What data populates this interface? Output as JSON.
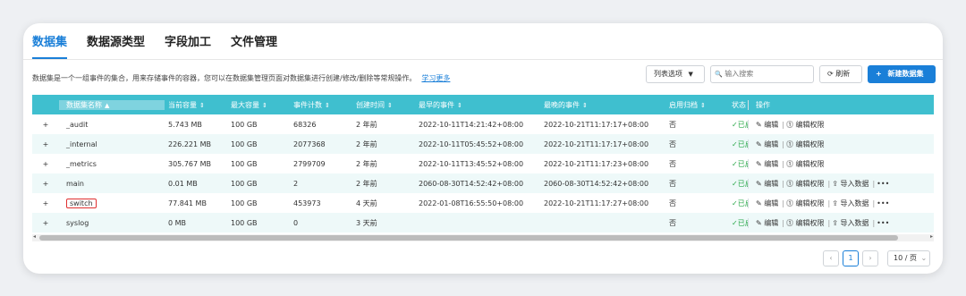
{
  "tabs": [
    "数据集",
    "数据源类型",
    "字段加工",
    "文件管理"
  ],
  "description": "数据集是一个一组事件的集合，用来存储事件的容器，您可以在数据集管理页面对数据集进行创建/修改/删除等常规操作。",
  "learn_more": "学习更多",
  "toolbar": {
    "columns_label": "列表选项",
    "columns_caret": "▼",
    "search_icon": "🔍",
    "search_placeholder": "输入搜索",
    "refresh_label": "刷新",
    "refresh_icon": "⟳",
    "new_label": "新建数据集",
    "new_icon": "+"
  },
  "table": {
    "headers": [
      "数据集名称",
      "当前容量",
      "最大容量",
      "事件计数",
      "创建时间",
      "最早的事件",
      "最晚的事件",
      "启用归档",
      "状态",
      "操作"
    ],
    "sort_icons": [
      "▲",
      "⇕",
      "⇕",
      "⇕",
      "⇕",
      "⇕",
      "⇕",
      "⇕"
    ],
    "expand_icon": "+",
    "rows": [
      {
        "name": "_audit",
        "cur": "5.743 MB",
        "max": "100 GB",
        "count": "68326",
        "created": "2 年前",
        "earliest": "2022-10-11T14:21:42+08:00",
        "latest": "2022-10-21T11:17:17+08:00",
        "archive": "否",
        "status": "✓已启",
        "actions": [
          "✎ 编辑",
          "⓵ 编辑权限"
        ]
      },
      {
        "name": "_internal",
        "cur": "226.221 MB",
        "max": "100 GB",
        "count": "2077368",
        "created": "2 年前",
        "earliest": "2022-10-11T05:45:52+08:00",
        "latest": "2022-10-21T11:17:17+08:00",
        "archive": "否",
        "status": "✓已启",
        "actions": [
          "✎ 编辑",
          "⓵ 编辑权限"
        ]
      },
      {
        "name": "_metrics",
        "cur": "305.767 MB",
        "max": "100 GB",
        "count": "2799709",
        "created": "2 年前",
        "earliest": "2022-10-11T13:45:52+08:00",
        "latest": "2022-10-21T11:17:23+08:00",
        "archive": "否",
        "status": "✓已启",
        "actions": [
          "✎ 编辑",
          "⓵ 编辑权限"
        ]
      },
      {
        "name": "main",
        "cur": "0.01 MB",
        "max": "100 GB",
        "count": "2",
        "created": "2 年前",
        "earliest": "2060-08-30T14:52:42+08:00",
        "latest": "2060-08-30T14:52:42+08:00",
        "archive": "否",
        "status": "✓已启",
        "actions": [
          "✎ 编辑",
          "⓵ 编辑权限",
          "⇪ 导入数据",
          "•••"
        ]
      },
      {
        "name": "switch",
        "cur": "77.841 MB",
        "max": "100 GB",
        "count": "453973",
        "created": "4 天前",
        "earliest": "2022-01-08T16:55:50+08:00",
        "latest": "2022-10-21T11:17:27+08:00",
        "archive": "否",
        "status": "✓已启",
        "actions": [
          "✎ 编辑",
          "⓵ 编辑权限",
          "⇪ 导入数据",
          "•••"
        ]
      },
      {
        "name": "syslog",
        "cur": "0 MB",
        "max": "100 GB",
        "count": "0",
        "created": "3 天前",
        "earliest": "",
        "latest": "",
        "archive": "否",
        "status": "✓已启",
        "actions": [
          "✎ 编辑",
          "⓵ 编辑权限",
          "⇪ 导入数据",
          "•••"
        ]
      }
    ]
  },
  "pagination": {
    "prev": "‹",
    "current": "1",
    "next": "›",
    "page_size": "10 / 页",
    "page_size_caret": "⌄"
  },
  "scrollbar": {
    "left": "◂",
    "right": "▸"
  },
  "colors": {
    "accent": "#1a7fd8",
    "header": "#3fbfcf",
    "status": "#2aa84a",
    "highlight": "#e03030"
  }
}
